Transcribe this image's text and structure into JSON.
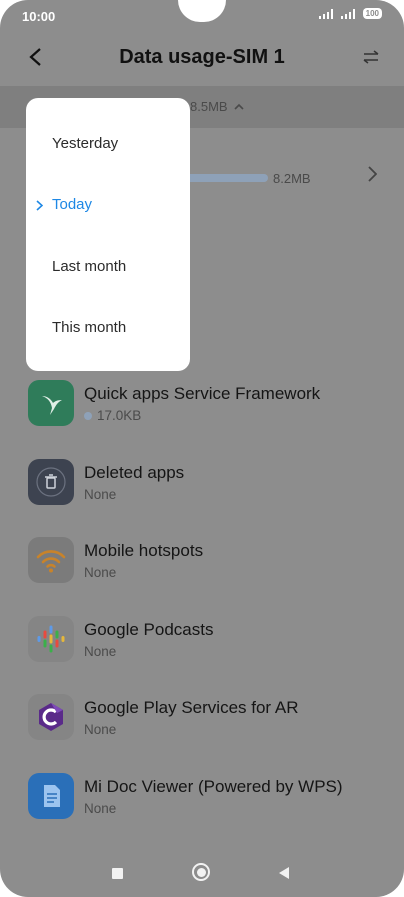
{
  "status": {
    "time": "10:00",
    "battery": "100"
  },
  "header": {
    "title": "Data usage-SIM 1"
  },
  "summary": {
    "total": "8.5MB",
    "usage_value": "8.2MB"
  },
  "dropdown": {
    "items": [
      {
        "label": "Yesterday",
        "selected": false
      },
      {
        "label": "Today",
        "selected": true
      },
      {
        "label": "Last month",
        "selected": false
      },
      {
        "label": "This month",
        "selected": false
      }
    ]
  },
  "apps": [
    {
      "name": "Quick apps Service Framework",
      "usage": "17.0KB",
      "icon": "hummingbird-icon",
      "icon_bg": "#2f7c5a"
    },
    {
      "name": "Deleted apps",
      "usage": "None",
      "icon": "trash-icon",
      "icon_bg": "#3d4350"
    },
    {
      "name": "Mobile hotspots",
      "usage": "None",
      "icon": "wifi-hotspot-icon",
      "icon_bg": "#7b7b7b"
    },
    {
      "name": "Google Podcasts",
      "usage": "None",
      "icon": "google-podcasts-icon",
      "icon_bg": "#858585"
    },
    {
      "name": "Google Play Services for AR",
      "usage": "None",
      "icon": "ar-core-icon",
      "icon_bg": "#858585"
    },
    {
      "name": "Mi Doc Viewer (Powered by WPS)",
      "usage": "None",
      "icon": "doc-viewer-icon",
      "icon_bg": "#2a6fb8"
    }
  ],
  "colors": {
    "accent": "#1e88e5",
    "overlay": "#8d8d8d",
    "usage_bar": "#8ea1b8"
  }
}
